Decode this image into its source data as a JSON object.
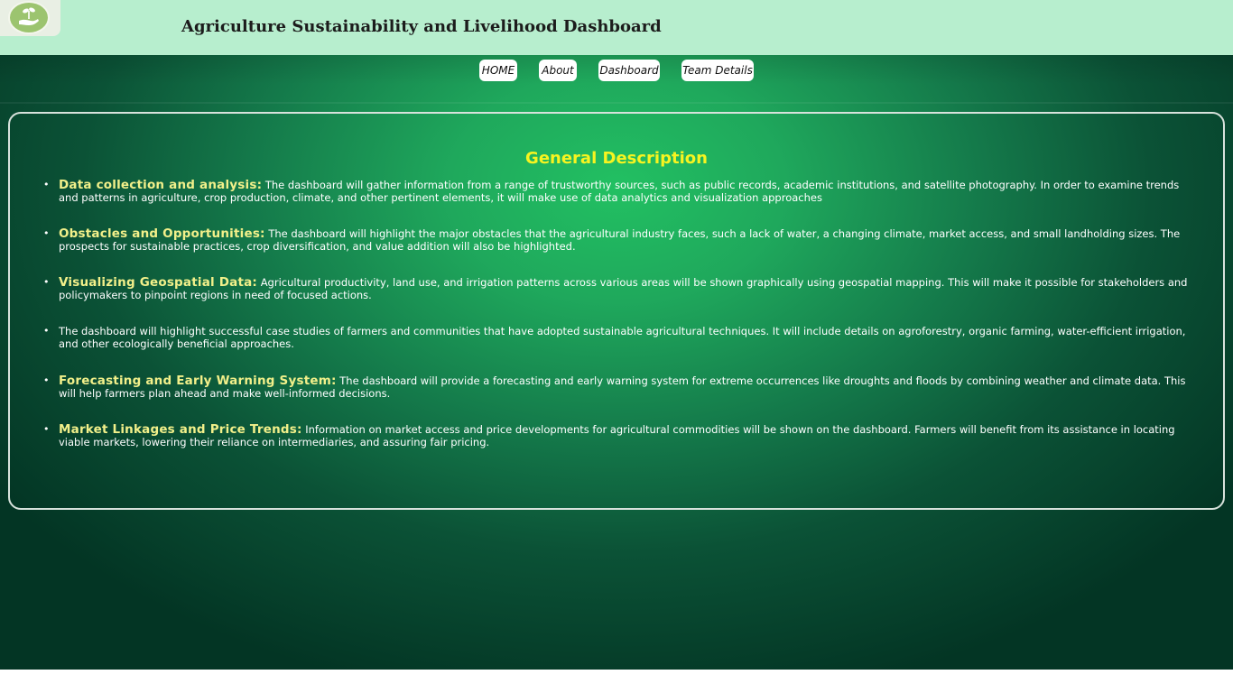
{
  "header": {
    "title": "Agriculture Sustainability and Livelihood Dashboard",
    "logo_icon": "hand-with-seedling-icon"
  },
  "nav": {
    "home": "HOME",
    "about": "About",
    "dashboard": "Dashboard",
    "team": "Team Details"
  },
  "main": {
    "title": "General Description",
    "items": [
      {
        "heading": "Data collection and analysis:",
        "text": "The dashboard will gather information from a range of trustworthy sources, such as public records, academic institutions, and satellite photography. In order to examine trends and patterns in agriculture, crop production, climate, and other pertinent elements, it will make use of data analytics and visualization approaches"
      },
      {
        "heading": "Obstacles and Opportunities:",
        "text": "The dashboard will highlight the major obstacles that the agricultural industry faces, such a lack of water, a changing climate, market access, and small landholding sizes. The prospects for sustainable practices, crop diversification, and value addition will also be highlighted."
      },
      {
        "heading": "Visualizing Geospatial Data:",
        "text": "Agricultural productivity, land use, and irrigation patterns across various areas will be shown graphically using geospatial mapping. This will make it possible for stakeholders and policymakers to pinpoint regions in need of focused actions."
      },
      {
        "heading": "",
        "text": "The dashboard will highlight successful case studies of farmers and communities that have adopted sustainable agricultural techniques. It will include details on agroforestry, organic farming, water-efficient irrigation, and other ecologically beneficial approaches."
      },
      {
        "heading": "Forecasting and Early Warning System:",
        "text": "The dashboard will provide a forecasting and early warning system for extreme occurrences like droughts and floods by combining weather and climate data. This will help farmers plan ahead and make well-informed decisions."
      },
      {
        "heading": "Market Linkages and Price Trends:",
        "text": "Information on market access and price developments for agricultural commodities will be shown on the dashboard. Farmers will benefit from its assistance in locating viable markets, lowering their reliance on intermediaries, and assuring fair pricing."
      }
    ]
  },
  "colors": {
    "header_bg": "#b7eece",
    "title_yellow": "#f7f420",
    "heading_yellow": "#f2f08a",
    "bg_green_light": "#22c062",
    "bg_green_dark": "#033524"
  }
}
